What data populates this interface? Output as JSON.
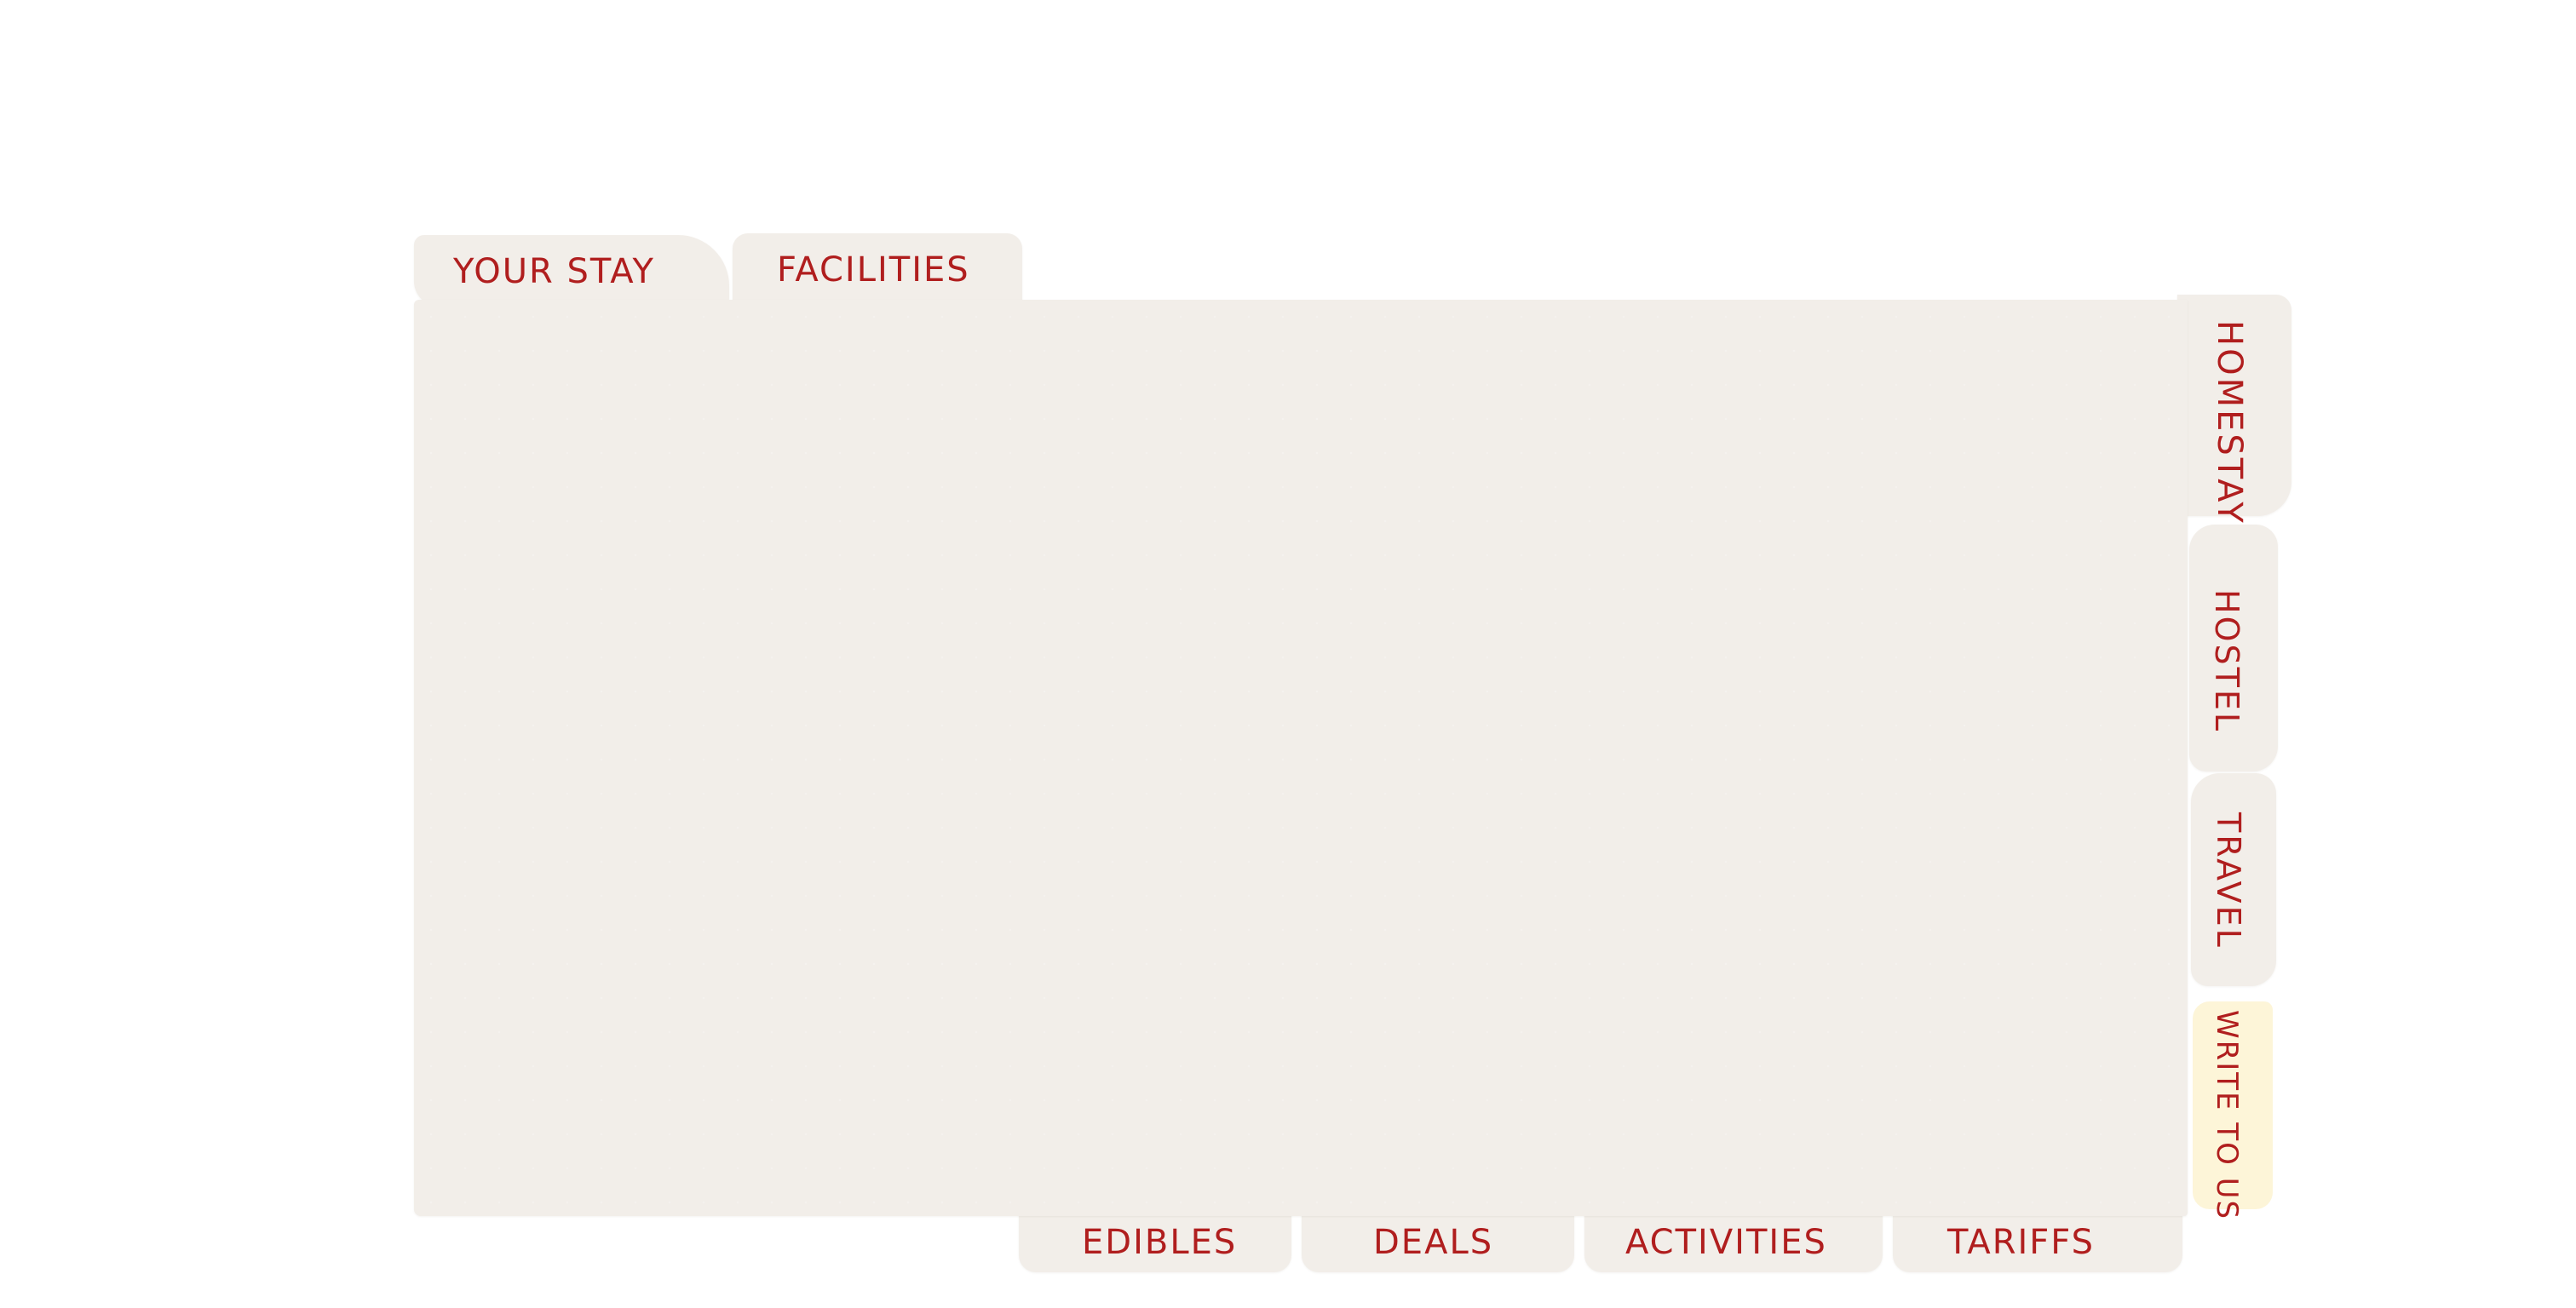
{
  "tabs": {
    "top": [
      {
        "label": "YOUR STAY"
      },
      {
        "label": "FACILITIES"
      }
    ],
    "side": [
      {
        "label": "HOMESTAY"
      },
      {
        "label": "HOSTEL"
      },
      {
        "label": "TRAVEL"
      },
      {
        "label": "WRITE TO US"
      }
    ],
    "bottom": [
      {
        "label": "EDIBLES"
      },
      {
        "label": "DEALS"
      },
      {
        "label": "ACTIVITIES"
      },
      {
        "label": "TARIFFS"
      }
    ]
  },
  "colors": {
    "paper": "#f2eee9",
    "label_red": "#b01e1e",
    "highlight_tab": "#fdf5d8",
    "background": "#ffffff"
  }
}
